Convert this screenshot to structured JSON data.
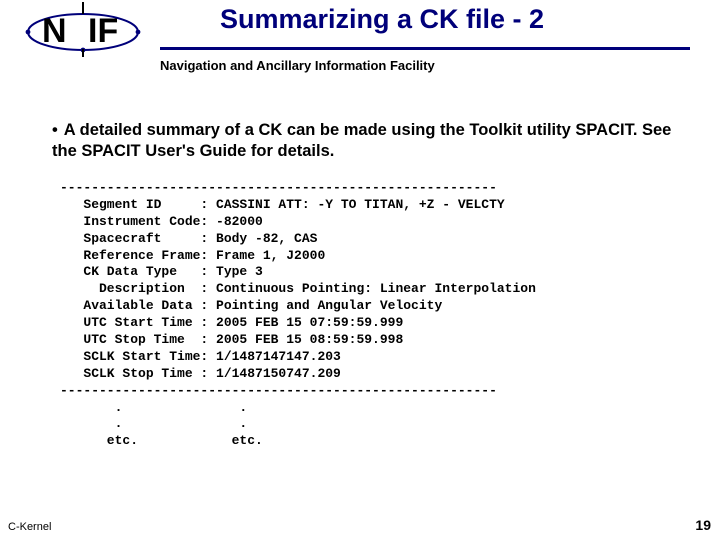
{
  "logo": {
    "text1": "N",
    "text2": "IF"
  },
  "title": "Summarizing a CK file - 2",
  "subtitle": "Navigation and Ancillary Information Facility",
  "bullet": "A detailed summary of a CK can be made using the Toolkit utility SPACIT.  See the SPACIT User's Guide for details.",
  "code": "--------------------------------------------------------\n   Segment ID     : CASSINI ATT: -Y TO TITAN, +Z - VELCTY\n   Instrument Code: -82000\n   Spacecraft     : Body -82, CAS\n   Reference Frame: Frame 1, J2000\n   CK Data Type   : Type 3\n     Description  : Continuous Pointing: Linear Interpolation\n   Available Data : Pointing and Angular Velocity\n   UTC Start Time : 2005 FEB 15 07:59:59.999\n   UTC Stop Time  : 2005 FEB 15 08:59:59.998\n   SCLK Start Time: 1/1487147147.203\n   SCLK Stop Time : 1/1487150747.209\n--------------------------------------------------------\n       .               .\n       .               .\n      etc.            etc.",
  "footer": {
    "left": "C-Kernel",
    "right": "19"
  }
}
